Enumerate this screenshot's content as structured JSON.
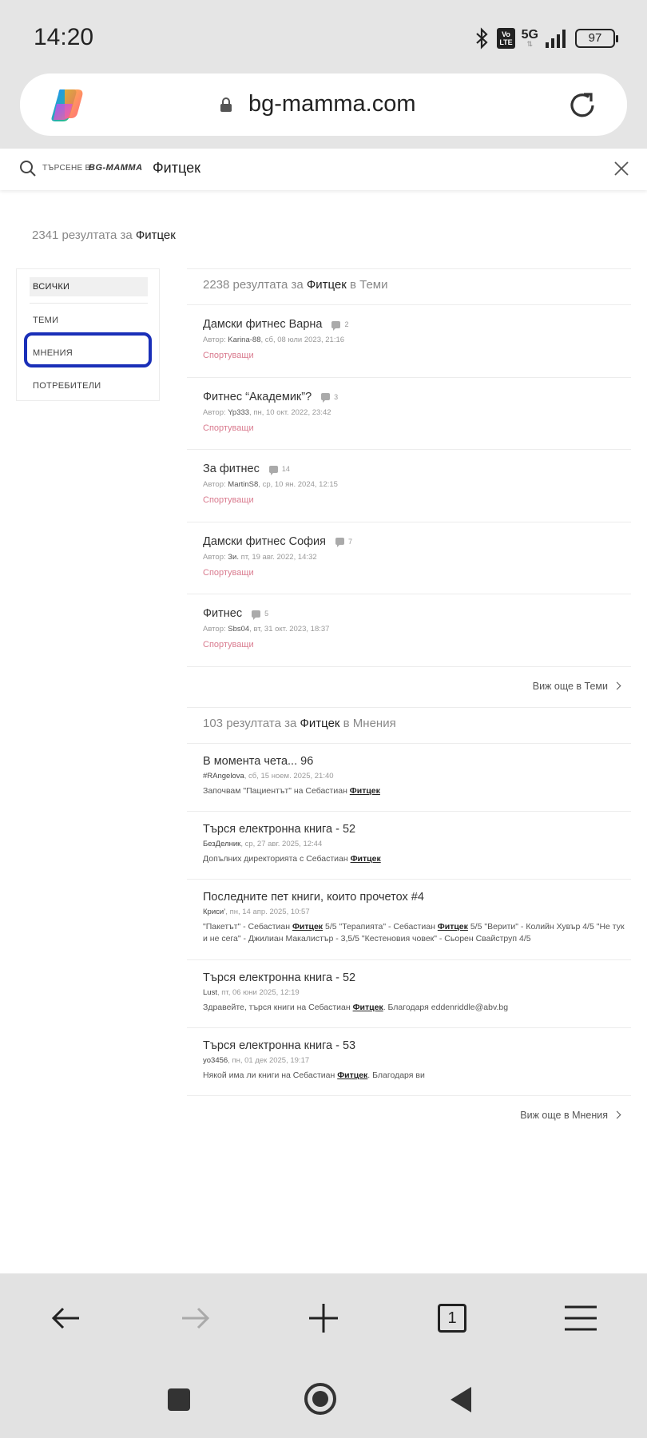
{
  "status_bar": {
    "time": "14:20",
    "network": "5G",
    "volte_label": "Vo\nLTE",
    "battery": "97"
  },
  "browser": {
    "url": "bg-mamma.com",
    "logo_icon": "copilot-icon",
    "reload_icon": "reload-icon"
  },
  "search": {
    "prefix": "ТЪРСЕНЕ В",
    "brand": "BG-MAMMA",
    "query": "Фитцек"
  },
  "summary": {
    "count_text": "2341 резултата за",
    "query": "Фитцек"
  },
  "filters": {
    "all": "ВСИЧКИ",
    "themes": "ТЕМИ",
    "opinions": "МНЕНИЯ",
    "users": "ПОТРЕБИТЕЛИ"
  },
  "themes_section": {
    "count_text": "2238 резултата за",
    "query": "Фитцек",
    "suffix": "в Теми",
    "more_label": "Виж още в Теми",
    "items": [
      {
        "title": "Дамски фитнес Варна",
        "comments": "2",
        "author_label": "Автор:",
        "author": "Karina-88",
        "date": ", сб, 08 юли 2023, 21:16",
        "category": "Спортуващи"
      },
      {
        "title": "Фитнес “Академик”?",
        "comments": "3",
        "author_label": "Автор:",
        "author": "Yp333",
        "date": ", пн, 10 окт. 2022, 23:42",
        "category": "Спортуващи"
      },
      {
        "title": "За фитнес",
        "comments": "14",
        "author_label": "Автор:",
        "author": "MartinS8",
        "date": ", ср, 10 ян. 2024, 12:15",
        "category": "Спортуващи"
      },
      {
        "title": "Дамски фитнес София",
        "comments": "7",
        "author_label": "Автор:",
        "author": "Зи.",
        "date": " пт, 19 авг. 2022, 14:32",
        "category": "Спортуващи"
      },
      {
        "title": "Фитнес",
        "comments": "5",
        "author_label": "Автор:",
        "author": "Sbs04",
        "date": ", вт, 31 окт. 2023, 18:37",
        "category": "Спортуващи"
      }
    ]
  },
  "opinions_section": {
    "count_text": "103 резултата за",
    "query": "Фитцек",
    "suffix": "в Мнения",
    "more_label": "Виж още в Мнения",
    "items": [
      {
        "title": "В момента чета... 96",
        "author": "#RAngelova",
        "date": ", сб, 15 ноем. 2025, 21:40",
        "text_before": "Започвам \"Пациентът\" на Себастиан ",
        "highlight": "Фитцек",
        "text_after": ""
      },
      {
        "title": "Търся електронна книга - 52",
        "author": "БезДелник",
        "date": ", ср, 27 авг. 2025, 12:44",
        "text_before": "Допълних директорията с Себастиан ",
        "highlight": "Фитцек",
        "text_after": ""
      },
      {
        "title": "Последните пет книги, които прочетох #4",
        "author": "Криси’",
        "date": ", пн, 14 апр. 2025, 10:57",
        "text_before": "\"Пакетът\" - Себастиан ",
        "highlight": "Фитцек",
        "text_middle": " 5/5 \"Терапията\" - Себастиан ",
        "highlight2": "Фитцек",
        "text_after": " 5/5 \"Верити\" - Колийн Хувър 4/5 \"Не тук и не сега\" - Джилиан Макалистър - 3,5/5 \"Кестеновия човек\" - Сьорен Свайструп 4/5"
      },
      {
        "title": "Търся електронна книга - 52",
        "author": "Lust",
        "date": ", пт, 06 юни 2025, 12:19",
        "text_before": "Здравейте, търся книги на Себастиан ",
        "highlight": "Фитцек",
        "text_after": ". Благодаря eddenriddle@abv.bg"
      },
      {
        "title": "Търся електронна книга - 53",
        "author": "yo3456",
        "date": ", пн, 01 дек 2025, 19:17",
        "text_before": "Някой има ли книги на Себастиан ",
        "highlight": "Фитцек",
        "text_after": ". Благодаря ви"
      }
    ]
  },
  "bottom_nav": {
    "tab_count": "1",
    "back_icon": "arrow-left-icon",
    "forward_icon": "arrow-right-icon",
    "new_tab_icon": "plus-icon",
    "menu_icon": "hamburger-icon"
  }
}
